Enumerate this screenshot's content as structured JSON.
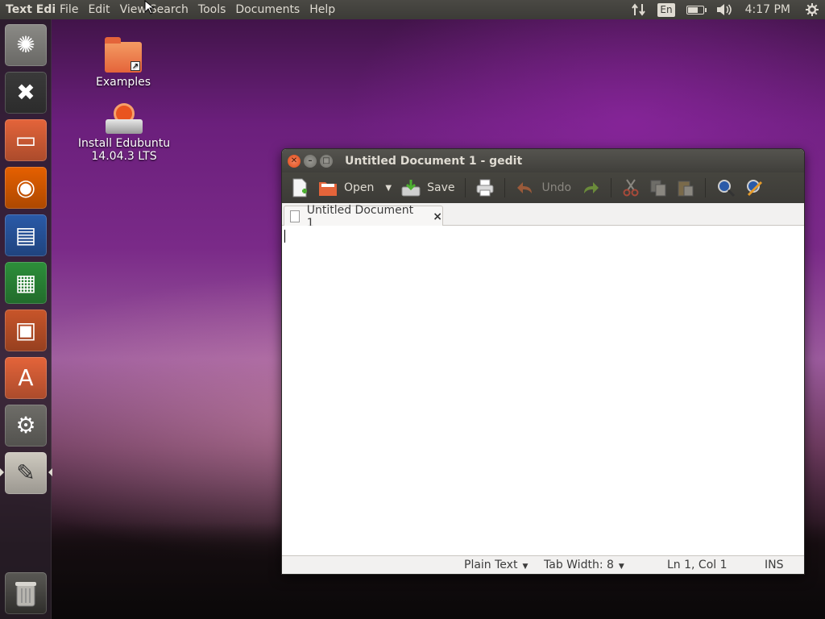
{
  "top_panel": {
    "app_name": "Text Edi",
    "menus": [
      "File",
      "Edit",
      "View",
      "Search",
      "Tools",
      "Documents",
      "Help"
    ],
    "language": "En",
    "clock": "4:17 PM",
    "battery_level": 0.6
  },
  "launcher": {
    "items": [
      {
        "name": "dash-home",
        "icon": "ubuntu-logo-icon",
        "glyph": "✺",
        "bg": "#8b8a86"
      },
      {
        "name": "xpad",
        "icon": "colorful-x-icon",
        "glyph": "✖",
        "bg": "#3a3a3a"
      },
      {
        "name": "files",
        "icon": "folder-icon",
        "glyph": "▭",
        "bg": "#e4643a"
      },
      {
        "name": "firefox",
        "icon": "firefox-icon",
        "glyph": "◉",
        "bg": "#e66000"
      },
      {
        "name": "libreoffice-writer",
        "icon": "writer-icon",
        "glyph": "▤",
        "bg": "#2a5aa8"
      },
      {
        "name": "libreoffice-calc",
        "icon": "calc-icon",
        "glyph": "▦",
        "bg": "#2d8f3a"
      },
      {
        "name": "libreoffice-impress",
        "icon": "impress-icon",
        "glyph": "▣",
        "bg": "#c8552a"
      },
      {
        "name": "ubuntu-software-center",
        "icon": "software-center-icon",
        "glyph": "A",
        "bg": "#e4643a"
      },
      {
        "name": "system-settings",
        "icon": "settings-gear-icon",
        "glyph": "⚙",
        "bg": "#6e6d68"
      },
      {
        "name": "gedit",
        "icon": "text-editor-icon",
        "glyph": "✎",
        "bg": "#cfcac0"
      }
    ],
    "trash_icon": "trash-icon"
  },
  "desktop": {
    "icons": [
      {
        "label": "Examples"
      },
      {
        "label_line1": "Install Edubuntu",
        "label_line2": "14.04.3 LTS"
      }
    ]
  },
  "window": {
    "title": "Untitled Document 1 - gedit",
    "toolbar": {
      "open_label": "Open",
      "save_label": "Save",
      "undo_label": "Undo"
    },
    "tab_label": "Untitled Document 1",
    "tab_close": "×",
    "status": {
      "language": "Plain Text",
      "tab_width": "Tab Width: 8",
      "position": "Ln 1, Col 1",
      "mode": "INS"
    }
  },
  "colors": {
    "panel": "#3c3b37",
    "accent": "#e95420",
    "panel_text": "#dfdbd2"
  }
}
